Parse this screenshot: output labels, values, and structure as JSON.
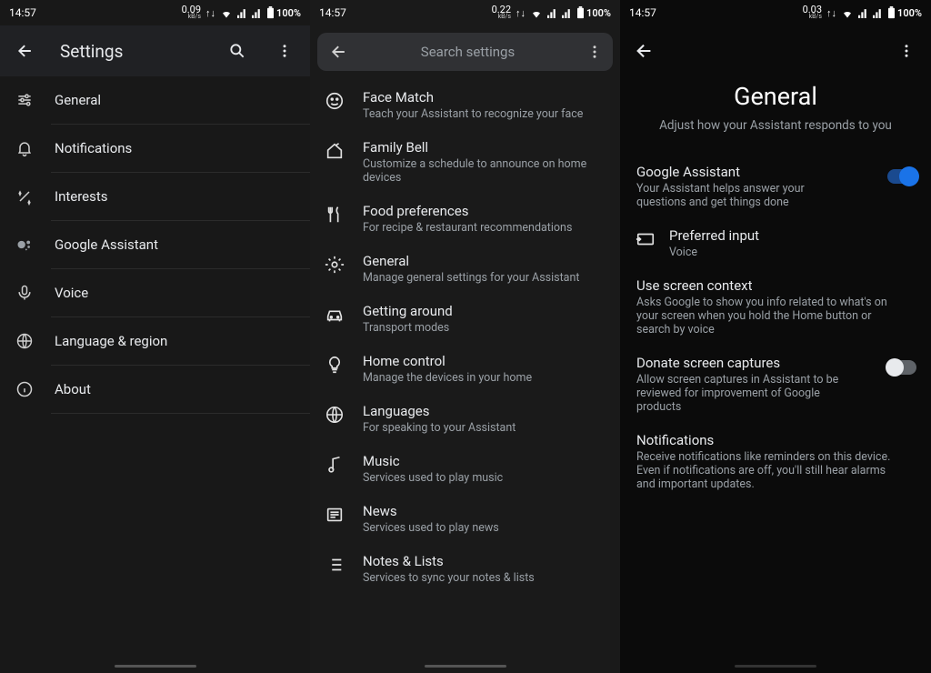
{
  "status": {
    "time": "14:57",
    "battery": "100%",
    "net1": "0.09",
    "net2": "0.22",
    "net3": "0.03",
    "kbs": "kB/s"
  },
  "p1": {
    "title": "Settings",
    "items": [
      {
        "label": "General"
      },
      {
        "label": "Notifications"
      },
      {
        "label": "Interests"
      },
      {
        "label": "Google Assistant"
      },
      {
        "label": "Voice"
      },
      {
        "label": "Language & region"
      },
      {
        "label": "About"
      }
    ]
  },
  "p2": {
    "searchPlaceholder": "Search settings",
    "items": [
      {
        "title": "Face Match",
        "sub": "Teach your Assistant to recognize your face"
      },
      {
        "title": "Family Bell",
        "sub": "Customize a schedule to announce on home devices"
      },
      {
        "title": "Food preferences",
        "sub": "For recipe & restaurant recommendations"
      },
      {
        "title": "General",
        "sub": "Manage general settings for your Assistant"
      },
      {
        "title": "Getting around",
        "sub": "Transport modes"
      },
      {
        "title": "Home control",
        "sub": "Manage the devices in your home"
      },
      {
        "title": "Languages",
        "sub": "For speaking to your Assistant"
      },
      {
        "title": "Music",
        "sub": "Services used to play music"
      },
      {
        "title": "News",
        "sub": "Services used to play news"
      },
      {
        "title": "Notes & Lists",
        "sub": "Services to sync your notes & lists"
      }
    ]
  },
  "p3": {
    "title": "General",
    "sub": "Adjust how your Assistant responds to you",
    "items": [
      {
        "title": "Google Assistant",
        "sub": "Your Assistant helps answer your questions and get things done"
      },
      {
        "title": "Preferred input",
        "sub": "Voice"
      },
      {
        "title": "Use screen context",
        "sub": "Asks Google to show you info related to what's on your screen when you hold the Home button or search by voice"
      },
      {
        "title": "Donate screen captures",
        "sub": "Allow screen captures in Assistant to be reviewed for improvement of Google products"
      },
      {
        "title": "Notifications",
        "sub": "Receive notifications like reminders on this device. Even if notifications are off, you'll still hear alarms and important updates."
      }
    ]
  }
}
